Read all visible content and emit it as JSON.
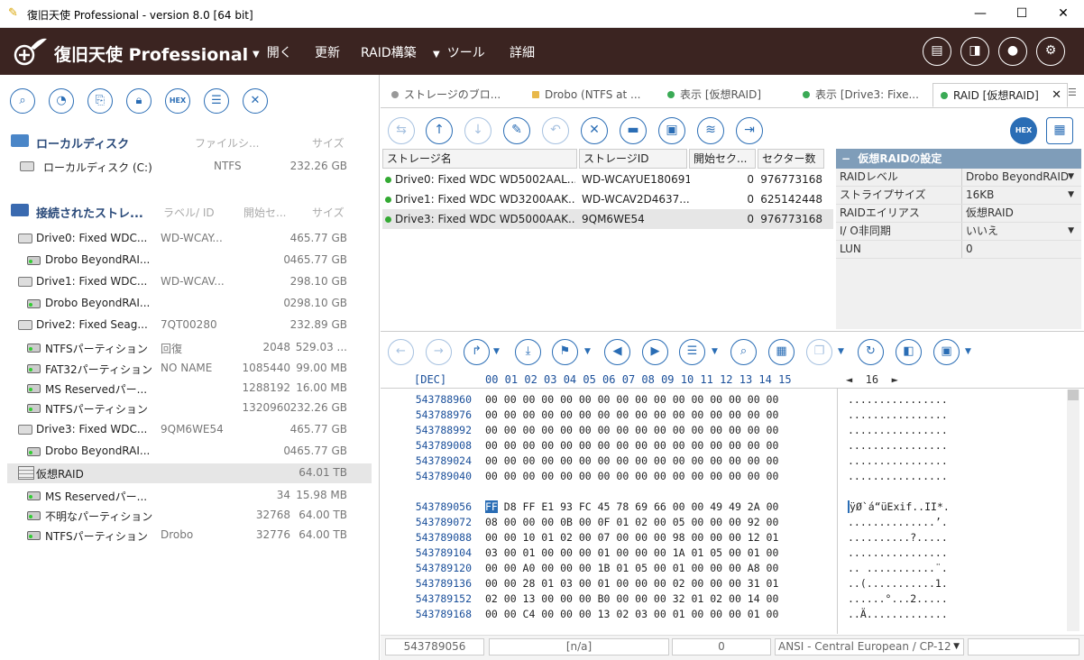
{
  "window": {
    "title": "復旧天使 Professional - version 8.0 [64 bit]"
  },
  "brand": {
    "name": "復旧天使 Professional"
  },
  "menu": [
    {
      "label": "開く",
      "has_arrow": true
    },
    {
      "label": "更新",
      "has_arrow": false
    },
    {
      "label": "RAID構築",
      "has_arrow": false
    },
    {
      "label": "ツール",
      "has_arrow": true
    },
    {
      "label": "詳細",
      "has_arrow": false
    }
  ],
  "left": {
    "toolbar_hex": "HEX",
    "local_section": {
      "title": "ローカルディスク",
      "col_fs": "ファイルシ...",
      "col_size": "サイズ"
    },
    "local_disks": [
      {
        "name": "ローカルディスク (C:)",
        "fs": "NTFS",
        "size": "232.26 GB"
      }
    ],
    "storage_section": {
      "title": "接続されたストレ...",
      "col_label": "ラベル/ ID",
      "col_start": "開始セ...",
      "col_size": "サイズ"
    },
    "items": [
      {
        "name": "Drive0: Fixed WDC...",
        "label": "WD-WCAY...",
        "start": "",
        "size": "465.77 GB",
        "kind": "drive"
      },
      {
        "name": "Drobo BeyondRAI...",
        "label": "",
        "start": "0",
        "size": "465.77 GB",
        "kind": "part"
      },
      {
        "name": "Drive1: Fixed WDC...",
        "label": "WD-WCAV...",
        "start": "",
        "size": "298.10 GB",
        "kind": "drive"
      },
      {
        "name": "Drobo BeyondRAI...",
        "label": "",
        "start": "0",
        "size": "298.10 GB",
        "kind": "part"
      },
      {
        "name": "Drive2: Fixed Seag...",
        "label": "7QT00280",
        "start": "",
        "size": "232.89 GB",
        "kind": "drive"
      },
      {
        "name": "NTFSパーティション",
        "label": "回復",
        "start": "2048",
        "size": "529.03 ...",
        "kind": "part"
      },
      {
        "name": "FAT32パーティション",
        "label": "NO NAME",
        "start": "1085440",
        "size": "99.00 MB",
        "kind": "part"
      },
      {
        "name": "MS Reservedパー...",
        "label": "",
        "start": "1288192",
        "size": "16.00 MB",
        "kind": "part"
      },
      {
        "name": "NTFSパーティション",
        "label": "",
        "start": "1320960",
        "size": "232.26 GB",
        "kind": "part"
      },
      {
        "name": "Drive3: Fixed WDC...",
        "label": "9QM6WE54",
        "start": "",
        "size": "465.77 GB",
        "kind": "drive"
      },
      {
        "name": "Drobo BeyondRAI...",
        "label": "",
        "start": "0",
        "size": "465.77 GB",
        "kind": "part"
      },
      {
        "name": "仮想RAID",
        "label": "",
        "start": "",
        "size": "64.01 TB",
        "kind": "raid"
      },
      {
        "name": "MS Reservedパー...",
        "label": "",
        "start": "34",
        "size": "15.98 MB",
        "kind": "part"
      },
      {
        "name": "不明なパーティション",
        "label": "",
        "start": "32768",
        "size": "64.00 TB",
        "kind": "part"
      },
      {
        "name": "NTFSパーティション",
        "label": "Drobo",
        "start": "32776",
        "size": "64.00 TB",
        "kind": "part"
      }
    ]
  },
  "tabs": [
    {
      "label": "ストレージのブロ...",
      "icon": "storage-icon",
      "color": "#999999"
    },
    {
      "label": "Drobo (NTFS at ...",
      "icon": "folder-icon",
      "color": "#e8b84a"
    },
    {
      "label": "表示 [仮想RAID]",
      "icon": "dot-icon",
      "color": "#3aaa55"
    },
    {
      "label": "表示 [Drive3: Fixe...",
      "icon": "dot-icon",
      "color": "#3aaa55"
    },
    {
      "label": "RAID [仮想RAID]",
      "icon": "dot-icon",
      "color": "#3aaa55"
    }
  ],
  "raid_tool_hex": "HEX",
  "drives_table": {
    "headers": [
      "ストレージ名",
      "ストレージID",
      "開始セク...",
      "セクター数"
    ],
    "rows": [
      {
        "name": "Drive0: Fixed WDC WD5002AAL...",
        "id": "WD-WCAYUE180691",
        "start": "0",
        "count": "976773168"
      },
      {
        "name": "Drive1: Fixed WDC WD3200AAK...",
        "id": "WD-WCAV2D4637...",
        "start": "0",
        "count": "625142448"
      },
      {
        "name": "Drive3: Fixed WDC WD5000AAK...",
        "id": "9QM6WE54",
        "start": "0",
        "count": "976773168"
      }
    ]
  },
  "raid_settings": {
    "title": "仮想RAIDの設定",
    "rows": [
      {
        "key": "RAIDレベル",
        "value": "Drobo BeyondRAID",
        "dropdown": true
      },
      {
        "key": "ストライプサイズ",
        "value": "16KB",
        "dropdown": true
      },
      {
        "key": "RAIDエイリアス",
        "value": "仮想RAID",
        "dropdown": false
      },
      {
        "key": "I/ O非同期",
        "value": "いいえ",
        "dropdown": true
      },
      {
        "key": "LUN",
        "value": "0",
        "dropdown": false
      }
    ]
  },
  "hex": {
    "dec_label": "[DEC]",
    "columns": "00 01 02 03 04 05 06 07 08 09 10 11 12 13 14 15",
    "width_nav": "◄  16  ►",
    "lines": [
      {
        "offset": "543788960",
        "bytes": "00 00 00 00 00 00 00 00 00 00 00 00 00 00 00 00",
        "ascii": "................"
      },
      {
        "offset": "543788976",
        "bytes": "00 00 00 00 00 00 00 00 00 00 00 00 00 00 00 00",
        "ascii": "................"
      },
      {
        "offset": "543788992",
        "bytes": "00 00 00 00 00 00 00 00 00 00 00 00 00 00 00 00",
        "ascii": "................"
      },
      {
        "offset": "543789008",
        "bytes": "00 00 00 00 00 00 00 00 00 00 00 00 00 00 00 00",
        "ascii": "................"
      },
      {
        "offset": "543789024",
        "bytes": "00 00 00 00 00 00 00 00 00 00 00 00 00 00 00 00",
        "ascii": "................"
      },
      {
        "offset": "543789040",
        "bytes": "00 00 00 00 00 00 00 00 00 00 00 00 00 00 00 00",
        "ascii": "................"
      },
      {
        "offset": "543789056",
        "first_byte": "FF",
        "bytes": " D8 FF E1 93 FC 45 78 69 66 00 00 49 49 2A 00",
        "first_ascii": "ÿ",
        "ascii": "Ø`á“üExif..II*."
      },
      {
        "offset": "543789072",
        "bytes": "08 00 00 00 0B 00 0F 01 02 00 05 00 00 00 92 00",
        "ascii": "..............’."
      },
      {
        "offset": "543789088",
        "bytes": "00 00 10 01 02 00 07 00 00 00 98 00 00 00 12 01",
        "ascii": "..........?....."
      },
      {
        "offset": "543789104",
        "bytes": "03 00 01 00 00 00 01 00 00 00 1A 01 05 00 01 00",
        "ascii": "................"
      },
      {
        "offset": "543789120",
        "bytes": "00 00 A0 00 00 00 1B 01 05 00 01 00 00 00 A8 00",
        "ascii": ".. ...........¨."
      },
      {
        "offset": "543789136",
        "bytes": "00 00 28 01 03 00 01 00 00 00 02 00 00 00 31 01",
        "ascii": "..(...........1."
      },
      {
        "offset": "543789152",
        "bytes": "02 00 13 00 00 00 B0 00 00 00 32 01 02 00 14 00",
        "ascii": "......°...2....."
      },
      {
        "offset": "543789168",
        "bytes": "00 00 C4 00 00 00 13 02 03 00 01 00 00 00 01 00",
        "ascii": "..Ä............."
      }
    ]
  },
  "status": {
    "offset": "543789056",
    "value": "[n/a]",
    "count": "0",
    "encoding": "ANSI - Central European / CP-12"
  }
}
